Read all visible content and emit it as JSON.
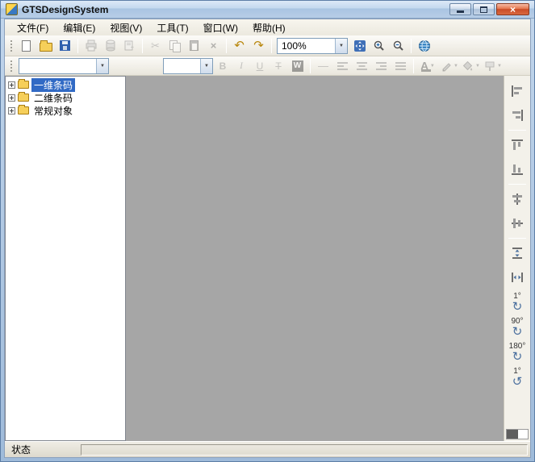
{
  "window": {
    "title": "GTSDesignSystem"
  },
  "menu": {
    "items": [
      {
        "label": "文件(F)"
      },
      {
        "label": "编辑(E)"
      },
      {
        "label": "视图(V)"
      },
      {
        "label": "工具(T)"
      },
      {
        "label": "窗口(W)"
      },
      {
        "label": "帮助(H)"
      }
    ]
  },
  "toolbar_main": {
    "zoom_value": "100%"
  },
  "toolbar_format": {
    "bold": "B",
    "italic": "I",
    "underline": "U",
    "strikethrough": "T",
    "word": "W",
    "font_color": "A"
  },
  "tree": {
    "items": [
      {
        "label": "一维条码",
        "selected": true
      },
      {
        "label": "二维条码",
        "selected": false
      },
      {
        "label": "常规对象",
        "selected": false
      }
    ]
  },
  "right_toolbar": {
    "rotations": [
      {
        "label": "1°"
      },
      {
        "label": "90°"
      },
      {
        "label": "180°"
      },
      {
        "label": "1°"
      }
    ]
  },
  "statusbar": {
    "text": "状态"
  },
  "icons": {
    "close": "×",
    "dropdown": "▼",
    "cut": "✂",
    "delete": "×",
    "undo": "↶",
    "redo": "↷",
    "rotate_cw": "↻",
    "rotate_ccw": "↺",
    "line": "—"
  },
  "colors": {
    "selection": "#316ac5",
    "canvas": "#a6a6a6",
    "titlebar_top": "#dce9f7",
    "titlebar_bottom": "#a9c4e2",
    "close_button": "#c94c26"
  }
}
